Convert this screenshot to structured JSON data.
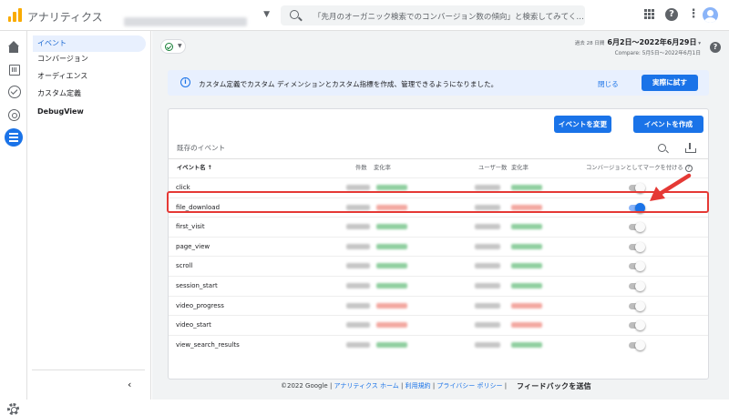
{
  "topbar": {
    "app_name": "アナリティクス",
    "search_placeholder": "「先月のオーガニック検索でのコンバージョン数の傾向」と検索してみてく…"
  },
  "subnav": {
    "items": [
      {
        "label": "イベント",
        "active": true
      },
      {
        "label": "コンバージョン",
        "active": false
      },
      {
        "label": "オーディエンス",
        "active": false
      },
      {
        "label": "カスタム定義",
        "active": false
      },
      {
        "label": "DebugView",
        "active": false
      }
    ],
    "collapse_glyph": "‹"
  },
  "header": {
    "date_prefix": "過去 28 日間",
    "date_range": "6月2日～2022年6月29日",
    "date_caret": "▾",
    "compare": "Compare: 5月5日～2022年6月1日"
  },
  "banner": {
    "message": "カスタム定義でカスタム ディメンションとカスタム指標を作成、管理できるようになりました。",
    "close_label": "閉じる",
    "try_label": "実際に試す"
  },
  "card": {
    "modify_button": "イベントを変更",
    "create_button": "イベントを作成",
    "title": "既存のイベント",
    "columns": {
      "event_name": "イベント名 ↑",
      "count": "件数",
      "count_change": "変化率",
      "users": "ユーザー数",
      "users_change": "変化率",
      "conversion": "コンバージョンとしてマークを付ける"
    },
    "rows": [
      {
        "name": "click",
        "conversion": false,
        "trend": "up"
      },
      {
        "name": "file_download",
        "conversion": true,
        "trend": "down"
      },
      {
        "name": "first_visit",
        "conversion": false,
        "trend": "up"
      },
      {
        "name": "page_view",
        "conversion": false,
        "trend": "up"
      },
      {
        "name": "scroll",
        "conversion": false,
        "trend": "up"
      },
      {
        "name": "session_start",
        "conversion": false,
        "trend": "up"
      },
      {
        "name": "video_progress",
        "conversion": false,
        "trend": "down"
      },
      {
        "name": "video_start",
        "conversion": false,
        "trend": "down"
      },
      {
        "name": "view_search_results",
        "conversion": false,
        "trend": "up"
      }
    ]
  },
  "footer": {
    "copyright": "©2022 Google",
    "sep": " | ",
    "links": [
      "アナリティクス ホーム",
      "利用規約",
      "プライバシー ポリシー"
    ],
    "feedback": "フィードバックを送信"
  },
  "colors": {
    "accent": "#1a73e8",
    "highlight": "#e53935",
    "logo": "#f9ab00"
  },
  "icons": [
    "logo-icon",
    "search-icon",
    "apps-icon",
    "help-icon",
    "more-icon",
    "home-icon",
    "reports-icon",
    "explore-icon",
    "advertising-icon",
    "configure-icon",
    "settings-icon",
    "info-icon",
    "download-icon",
    "check-icon"
  ]
}
